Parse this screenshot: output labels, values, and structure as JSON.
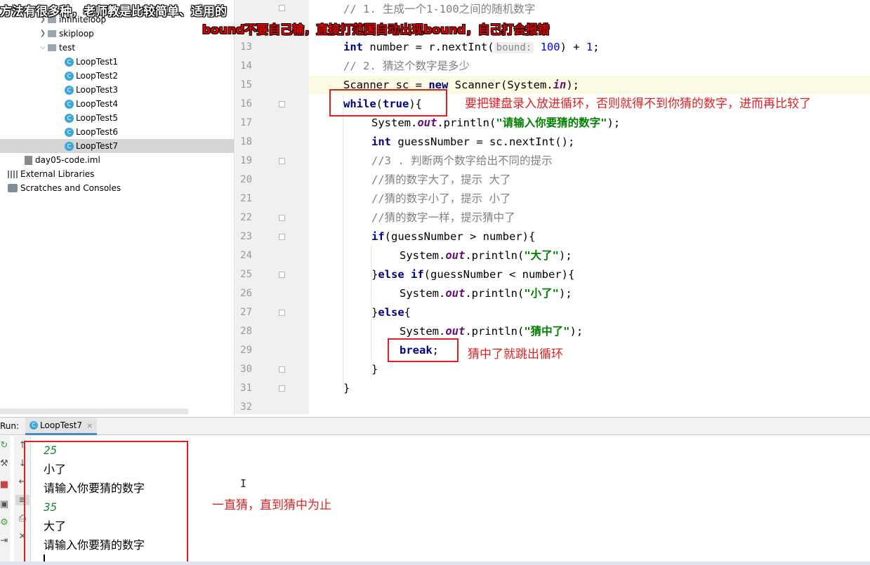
{
  "overlay": {
    "top_caption": "方法有很多种，老师教是比较简单、适用的",
    "bound_caption": "bound不要自己输，直接打范围自动出现bound，自己打会报错"
  },
  "project_tree": {
    "items": [
      {
        "label": "infiniteloop",
        "kind": "folder",
        "expanded": false
      },
      {
        "label": "skiploop",
        "kind": "folder",
        "expanded": false
      },
      {
        "label": "test",
        "kind": "folder",
        "expanded": true
      },
      {
        "label": "LoopTest1",
        "kind": "class"
      },
      {
        "label": "LoopTest2",
        "kind": "class"
      },
      {
        "label": "LoopTest3",
        "kind": "class"
      },
      {
        "label": "LoopTest4",
        "kind": "class"
      },
      {
        "label": "LoopTest5",
        "kind": "class"
      },
      {
        "label": "LoopTest6",
        "kind": "class"
      },
      {
        "label": "LoopTest7",
        "kind": "class",
        "selected": true
      },
      {
        "label": "day05-code.iml",
        "kind": "iml"
      },
      {
        "label": "External Libraries",
        "kind": "libraries"
      },
      {
        "label": "Scratches and Consoles",
        "kind": "scratches"
      }
    ]
  },
  "editor": {
    "line_numbers": [
      "13",
      "14",
      "15",
      "16",
      "17",
      "18",
      "19",
      "20",
      "21",
      "22",
      "23",
      "24",
      "25",
      "26",
      "27",
      "28",
      "29",
      "30",
      "31",
      "32"
    ],
    "line12_comment": "// 1. 生成一个1-100之间的随机数字",
    "line13": {
      "pre": "int",
      "mid": " number = r.nextInt(",
      "hint": "bound:",
      "num1": "100",
      "post": ") + ",
      "num2": "1",
      "end": ";"
    },
    "line14_comment": "// 2. 猜这个数字是多少",
    "line15": {
      "pre": "Scanner sc = ",
      "kw": "new",
      "mid": " Scanner(System.",
      "fld": "in",
      "end": ");"
    },
    "line16": {
      "kw": "while",
      "p1": "(",
      "kw2": "true",
      "p2": "){"
    },
    "line17": {
      "pre": "System.",
      "fld": "out",
      "mid": ".println(",
      "str": "\"请输入你要猜的数字\"",
      "end": ");"
    },
    "line18": {
      "kw": "int",
      "rest": " guessNumber = sc.nextInt();"
    },
    "line19_comment": "//3 . 判断两个数字给出不同的提示",
    "line20_comment": "//猜的数字大了，提示 大了",
    "line21_comment": "//猜的数字小了，提示 小了",
    "line22_comment": "//猜的数字一样，提示猜中了",
    "line23": {
      "kw": "if",
      "rest": "(guessNumber > number){"
    },
    "line24": {
      "pre": "System.",
      "fld": "out",
      "mid": ".println(",
      "str": "\"大了\"",
      "end": ");"
    },
    "line25": {
      "p1": "}",
      "kw": "else if",
      "rest": "(guessNumber < number){"
    },
    "line26": {
      "pre": "System.",
      "fld": "out",
      "mid": ".println(",
      "str": "\"小了\"",
      "end": ");"
    },
    "line27": {
      "p1": "}",
      "kw": "else",
      "rest": "{"
    },
    "line28": {
      "pre": "System.",
      "fld": "out",
      "mid": ".println(",
      "str": "\"猜中了\"",
      "end": ");"
    },
    "line29": {
      "kw": "break",
      "end": ";"
    },
    "line30": "}",
    "line31": "}",
    "line_paren_fragment": "()"
  },
  "annotations": {
    "while_note": "要把键盘录入放进循环，否则就得不到你猜的数字，进而再比较了",
    "break_note": "猜中了就跳出循环",
    "console_note": "一直猜，直到猜中为止"
  },
  "run_panel": {
    "label": "Run:",
    "tab_name": "LoopTest7",
    "tab_close": "×",
    "console_lines": [
      {
        "text": "25",
        "type": "input"
      },
      {
        "text": "小了",
        "type": "output"
      },
      {
        "text": "请输入你要猜的数字",
        "type": "output"
      },
      {
        "text": "35",
        "type": "input"
      },
      {
        "text": "大了",
        "type": "output"
      },
      {
        "text": "请输入你要猜的数字",
        "type": "output"
      }
    ]
  },
  "colors": {
    "annotation_red": "#e02020",
    "keyword": "#000080",
    "string": "#008000",
    "comment": "#808080",
    "console_input": "#1a8a3a"
  }
}
